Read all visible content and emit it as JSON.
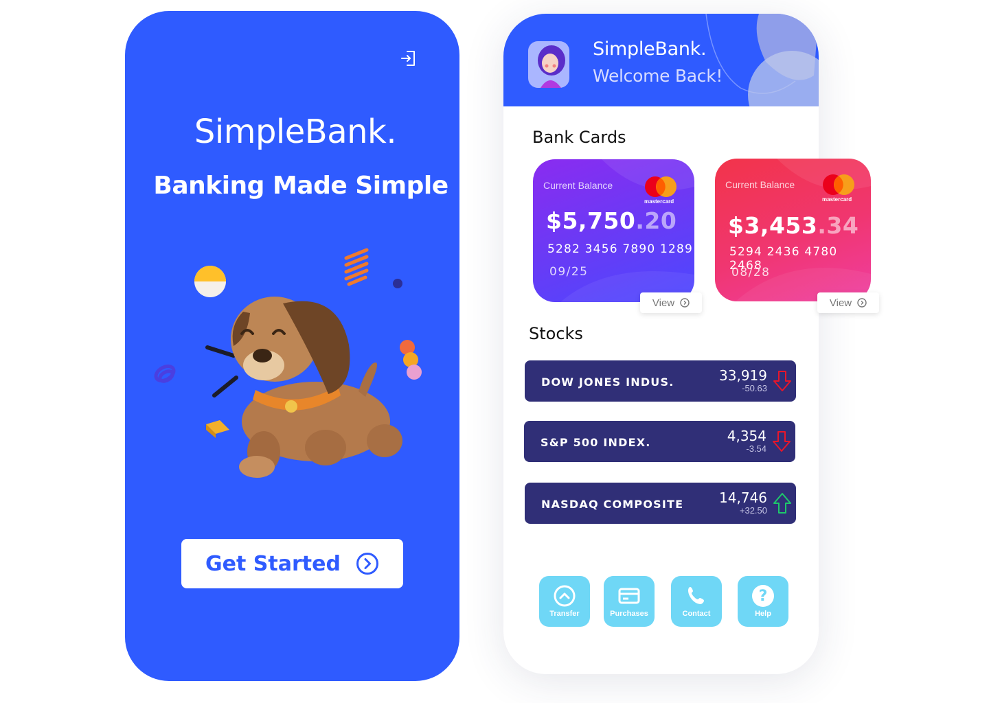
{
  "onboarding": {
    "brand": "SimpleBank.",
    "tagline": "Banking Made Simple",
    "cta_label": "Get Started",
    "icons": {
      "login": "login-icon",
      "cta": "chevron-right-circle-icon"
    }
  },
  "dashboard": {
    "brand": "SimpleBank.",
    "welcome": "Welcome Back!",
    "bank_cards_title": "Bank Cards",
    "stocks_title": "Stocks",
    "cards": [
      {
        "label": "Current Balance",
        "amount_main": "$5,750",
        "amount_cents": ".20",
        "number": "5282 3456 7890 1289",
        "expiry": "09/25",
        "network": "mastercard",
        "view_label": "View"
      },
      {
        "label": "Current Balance",
        "amount_main": "$3,453",
        "amount_cents": ".34",
        "number": "5294 2436 4780 2468",
        "expiry": "08/28",
        "network": "mastercard",
        "view_label": "View"
      }
    ],
    "stocks": [
      {
        "name": "DOW JONES INDUS.",
        "value": "33,919",
        "change": "-50.63",
        "direction": "down"
      },
      {
        "name": "S&P 500 INDEX.",
        "value": "4,354",
        "change": "-3.54",
        "direction": "down"
      },
      {
        "name": "NASDAQ COMPOSITE",
        "value": "14,746",
        "change": "+32.50",
        "direction": "up"
      }
    ],
    "actions": [
      {
        "label": "Transfer",
        "icon": "transfer-icon"
      },
      {
        "label": "Purchases",
        "icon": "credit-card-icon"
      },
      {
        "label": "Contact",
        "icon": "phone-icon"
      },
      {
        "label": "Help",
        "icon": "help-icon"
      }
    ]
  },
  "colors": {
    "primary": "#2f5bff",
    "stock_bg": "#302f77",
    "action_bg": "#6fd7f6",
    "down": "#e8162a",
    "up": "#1ec86b"
  }
}
